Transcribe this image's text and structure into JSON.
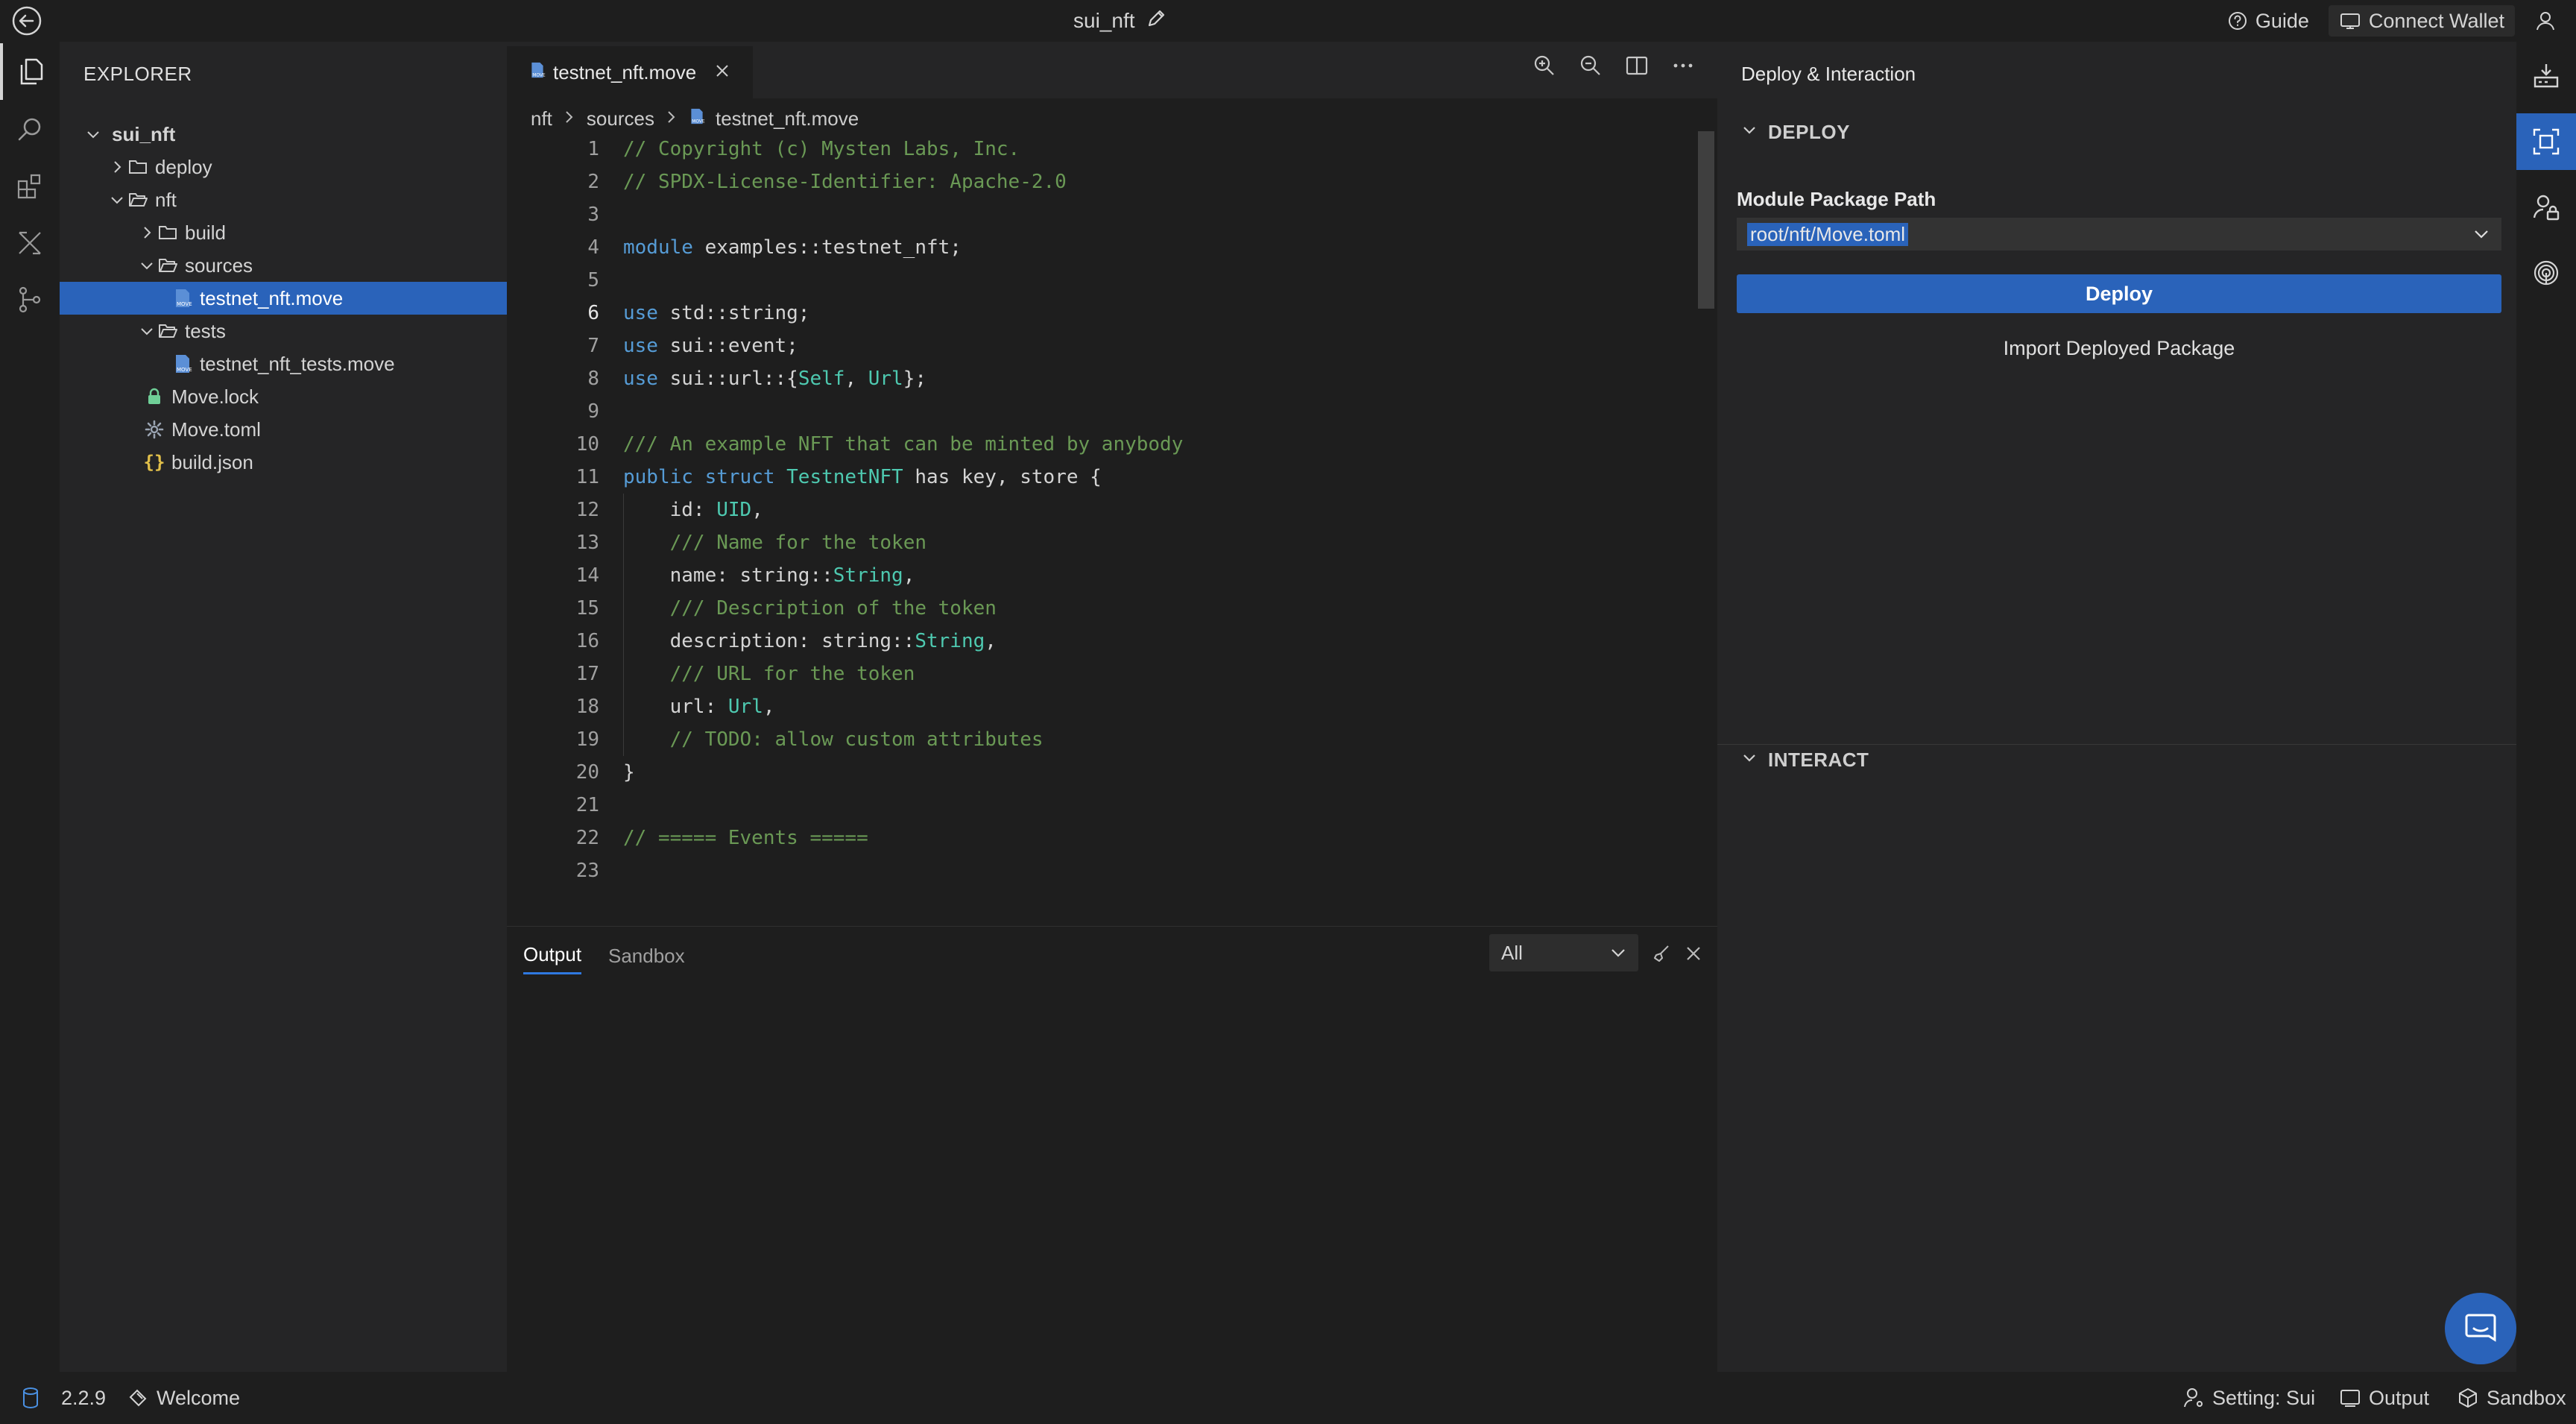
{
  "titlebar": {
    "project_name": "sui_nft",
    "guide_label": "Guide",
    "connect_wallet_label": "Connect Wallet"
  },
  "activity_bar": {
    "items": [
      "files-icon",
      "search-icon",
      "extensions-icon",
      "compare-icon",
      "source-control-icon"
    ],
    "active": "files-icon"
  },
  "right_activity_bar": {
    "items": [
      "download-icon",
      "deploy-interact-icon",
      "user-lock-icon",
      "fingerprint-icon"
    ],
    "active": "deploy-interact-icon"
  },
  "explorer": {
    "title": "EXPLORER",
    "tree": [
      {
        "label": "sui_nft",
        "type": "root"
      },
      {
        "label": "deploy",
        "type": "folder",
        "expanded": false
      },
      {
        "label": "nft",
        "type": "folder",
        "expanded": true
      },
      {
        "label": "build",
        "type": "folder",
        "expanded": false
      },
      {
        "label": "sources",
        "type": "folder",
        "expanded": true
      },
      {
        "label": "testnet_nft.move",
        "type": "move-file",
        "selected": true
      },
      {
        "label": "tests",
        "type": "folder",
        "expanded": true
      },
      {
        "label": "testnet_nft_tests.move",
        "type": "move-file"
      },
      {
        "label": "Move.lock",
        "type": "lock-file"
      },
      {
        "label": "Move.toml",
        "type": "settings-file"
      },
      {
        "label": "build.json",
        "type": "json-file"
      }
    ]
  },
  "editor": {
    "tab_label": "testnet_nft.move",
    "breadcrumb": [
      "nft",
      "sources",
      "testnet_nft.move"
    ],
    "active_line": 6,
    "lines": [
      {
        "n": "1",
        "text": "// Copyright (c) Mysten Labs, Inc."
      },
      {
        "n": "2",
        "text": "// SPDX-License-Identifier: Apache-2.0"
      },
      {
        "n": "3",
        "text": ""
      },
      {
        "n": "4",
        "text": "module examples::testnet_nft;"
      },
      {
        "n": "5",
        "text": ""
      },
      {
        "n": "6",
        "text": "use std::string;"
      },
      {
        "n": "7",
        "text": "use sui::event;"
      },
      {
        "n": "8",
        "text": "use sui::url::{Self, Url};"
      },
      {
        "n": "9",
        "text": ""
      },
      {
        "n": "10",
        "text": "/// An example NFT that can be minted by anybody"
      },
      {
        "n": "11",
        "text": "public struct TestnetNFT has key, store {"
      },
      {
        "n": "12",
        "text": "    id: UID,"
      },
      {
        "n": "13",
        "text": "    /// Name for the token"
      },
      {
        "n": "14",
        "text": "    name: string::String,"
      },
      {
        "n": "15",
        "text": "    /// Description of the token"
      },
      {
        "n": "16",
        "text": "    description: string::String,"
      },
      {
        "n": "17",
        "text": "    /// URL for the token"
      },
      {
        "n": "18",
        "text": "    url: Url,"
      },
      {
        "n": "19",
        "text": "    // TODO: allow custom attributes"
      },
      {
        "n": "20",
        "text": "}"
      },
      {
        "n": "21",
        "text": ""
      },
      {
        "n": "22",
        "text": "// ===== Events ====="
      },
      {
        "n": "23",
        "text": ""
      }
    ]
  },
  "panel": {
    "tabs": [
      "Output",
      "Sandbox"
    ],
    "active_tab": "Output",
    "filter_value": "All"
  },
  "deploy_panel": {
    "title": "Deploy & Interaction",
    "deploy_section": "DEPLOY",
    "package_path_label": "Module Package Path",
    "package_path_value": "root/nft/Move.toml",
    "deploy_button": "Deploy",
    "import_link": "Import Deployed Package",
    "interact_section": "INTERACT"
  },
  "statusbar": {
    "version": "2.2.9",
    "welcome": "Welcome",
    "setting": "Setting: Sui",
    "output": "Output",
    "sandbox": "Sandbox"
  },
  "colors": {
    "accent": "#2a63ba",
    "background": "#1e1e1e",
    "sidebar": "#252526",
    "comment": "#6a9955",
    "keyword": "#569cd6",
    "type": "#4ec9b0"
  }
}
